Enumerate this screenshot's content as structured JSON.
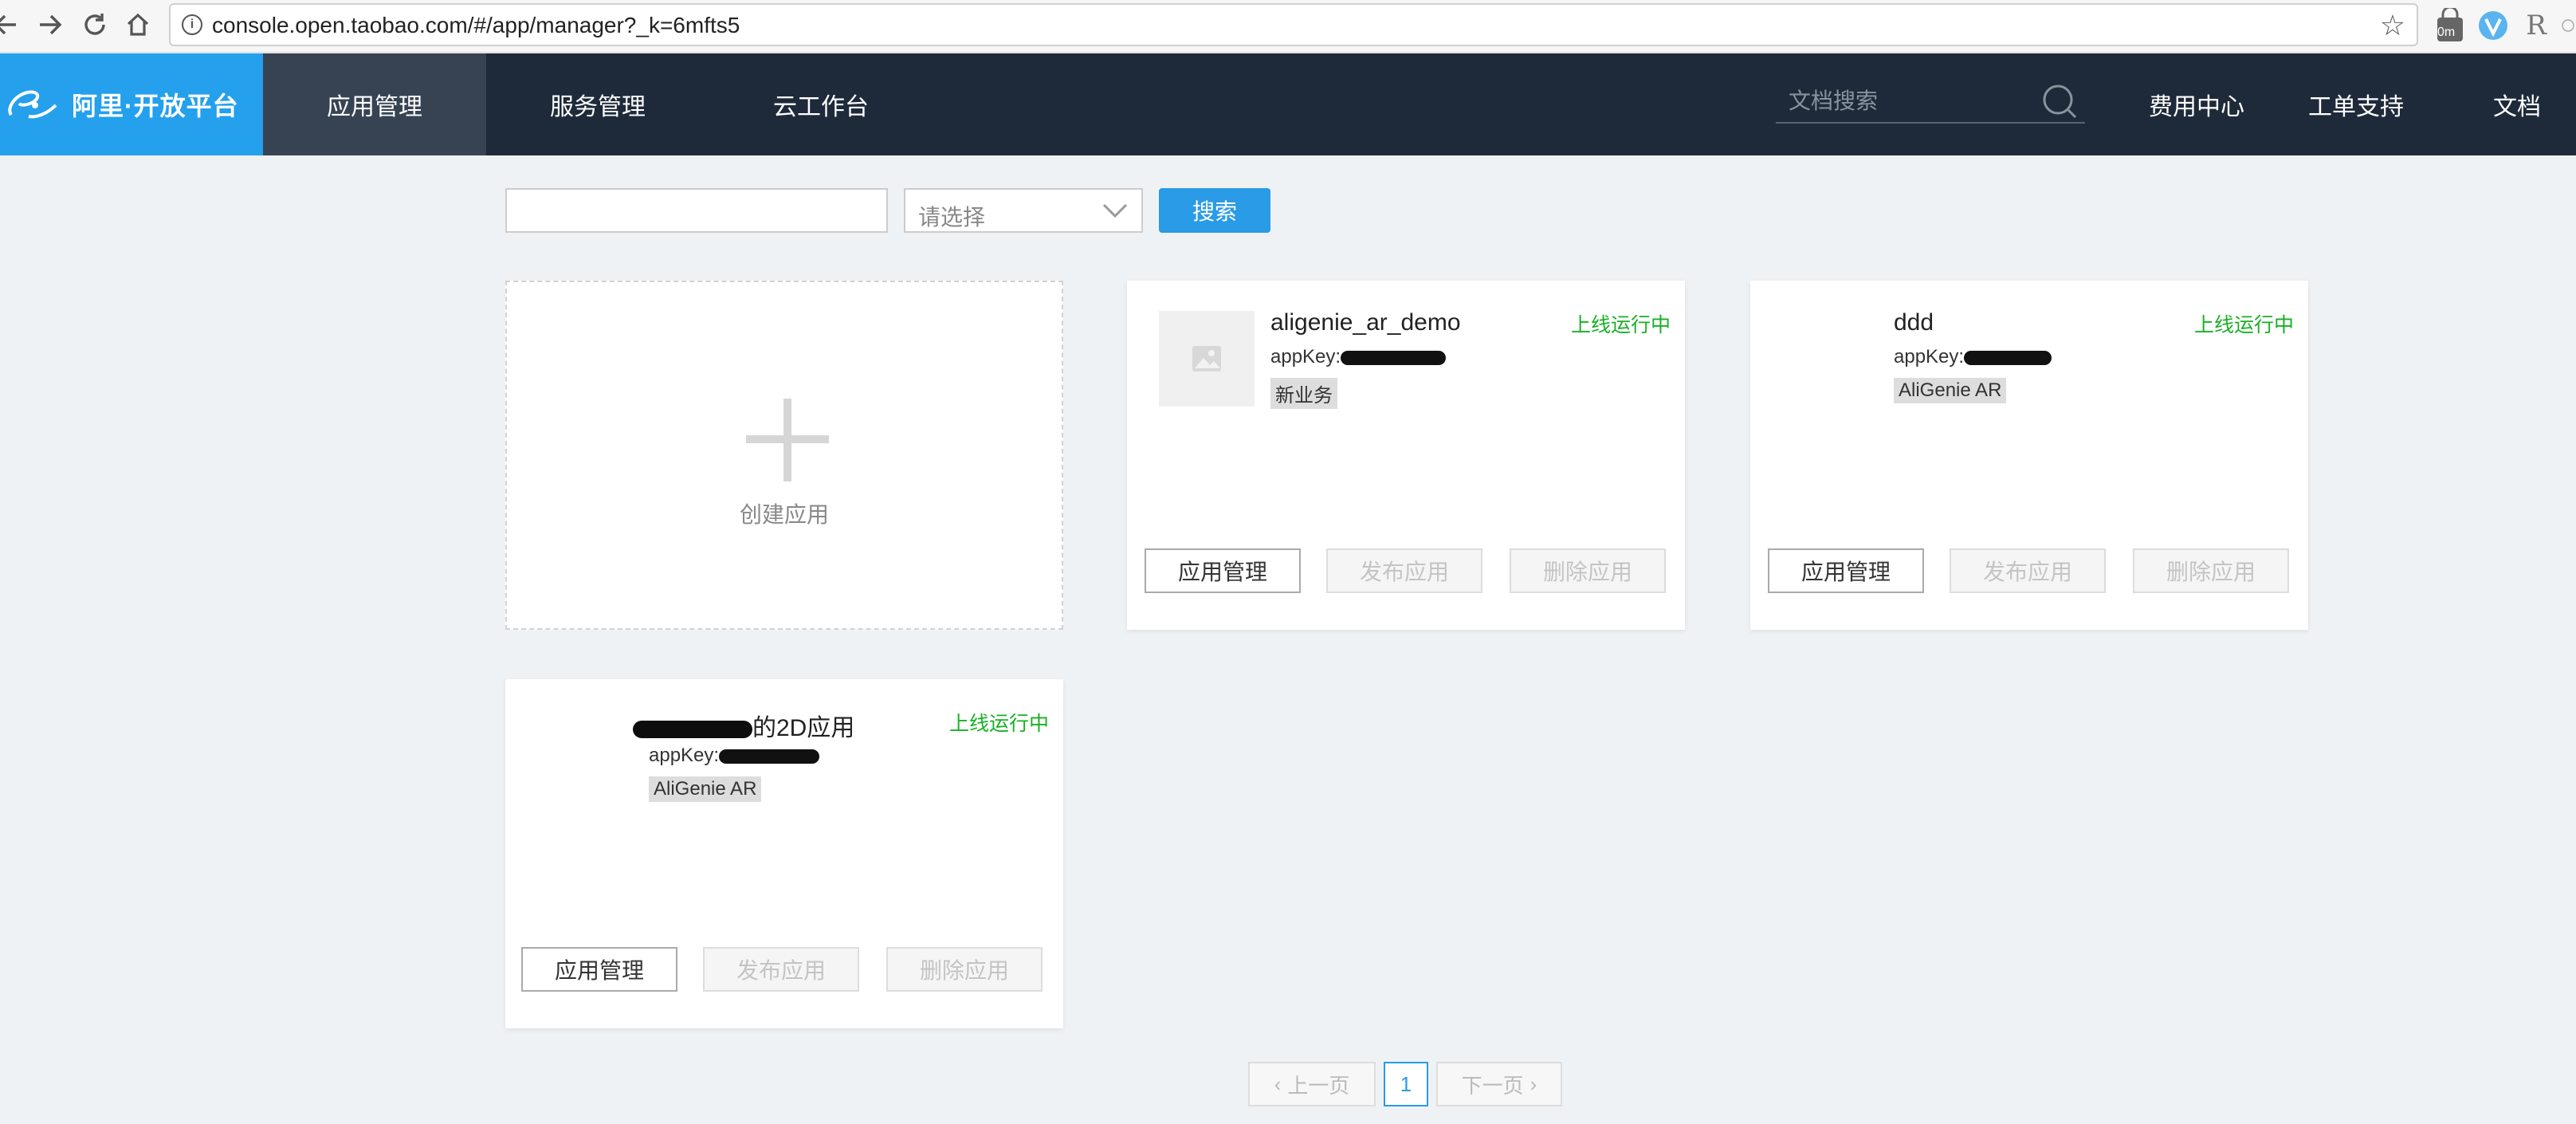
{
  "browser": {
    "url": "console.open.taobao.com/#/app/manager?_k=6mfts5",
    "ext_badge": "0m",
    "ext_r": "R"
  },
  "brand": {
    "name": "阿里·开放平台"
  },
  "nav": {
    "items": [
      "应用管理",
      "服务管理",
      "云工作台"
    ],
    "search_placeholder": "文档搜索",
    "right": [
      "费用中心",
      "工单支持",
      "文档"
    ]
  },
  "filter": {
    "input_value": "",
    "select_placeholder": "请选择",
    "search_label": "搜索"
  },
  "create": {
    "label": "创建应用"
  },
  "apps": [
    {
      "name": "aligenie_ar_demo",
      "key_label": "appKey:",
      "tag": "新业务",
      "status": "上线运行中",
      "has_thumb": true
    },
    {
      "name": "ddd",
      "key_label": "appKey:",
      "tag": "AliGenie AR",
      "status": "上线运行中",
      "has_thumb": false
    },
    {
      "name_suffix": "的2D应用",
      "key_label": "appKey:",
      "tag": "AliGenie AR",
      "status": "上线运行中",
      "has_thumb": false
    }
  ],
  "card_buttons": {
    "manage": "应用管理",
    "publish": "发布应用",
    "delete": "删除应用"
  },
  "pagination": {
    "prev": "上一页",
    "current": "1",
    "next": "下一页"
  },
  "colors": {
    "nav_bg": "#1e2a3a",
    "brand_bg": "#24a0ec",
    "status_green": "#19b025",
    "primary": "#2a9be6"
  }
}
